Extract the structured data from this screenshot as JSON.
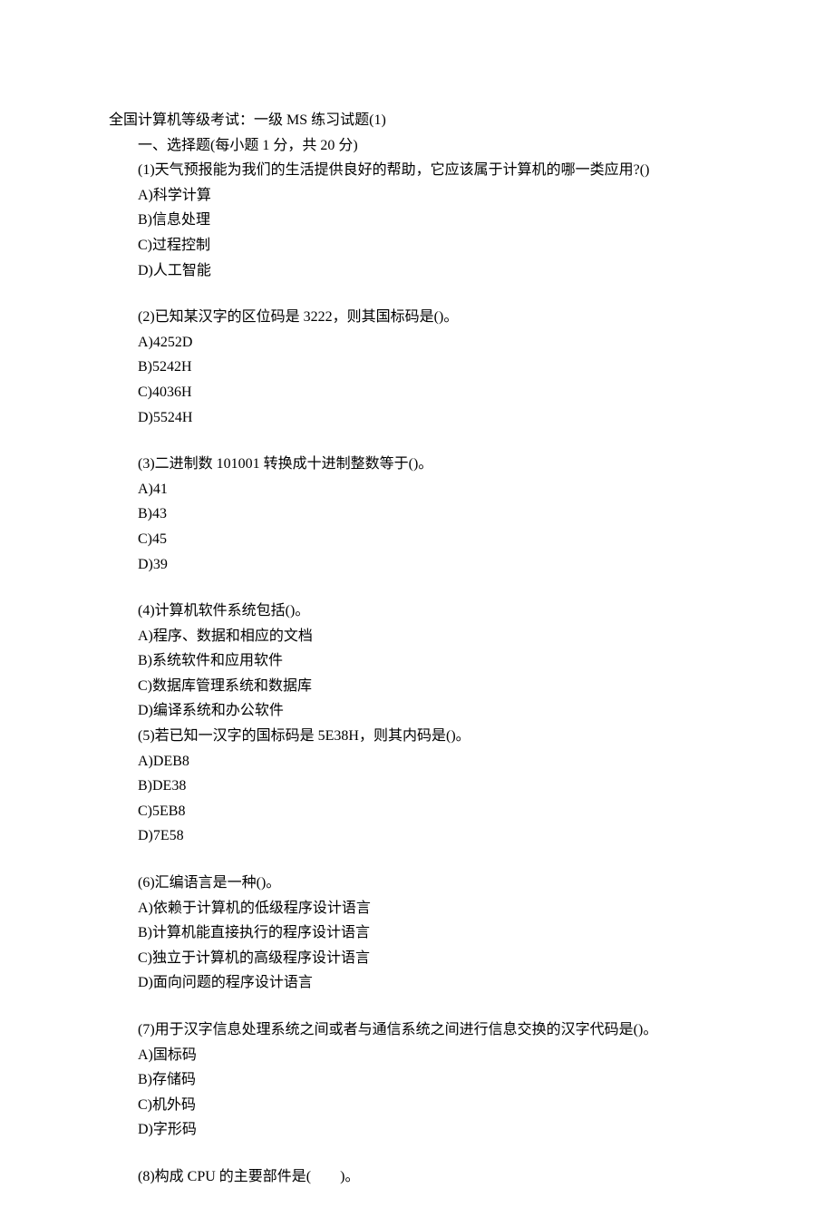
{
  "title": "全国计算机等级考试：一级 MS 练习试题(1)",
  "section_header": "一、选择题(每小题 1 分，共 20 分)",
  "questions": [
    {
      "prompt": "(1)天气预报能为我们的生活提供良好的帮助，它应该属于计算机的哪一类应用?()",
      "options": [
        "A)科学计算",
        "B)信息处理",
        "C)过程控制",
        "D)人工智能"
      ]
    },
    {
      "prompt": "(2)已知某汉字的区位码是 3222，则其国标码是()。",
      "options": [
        "A)4252D",
        "B)5242H",
        "C)4036H",
        "D)5524H"
      ]
    },
    {
      "prompt": "(3)二进制数 101001 转换成十进制整数等于()。",
      "options": [
        "A)41",
        "B)43",
        "C)45",
        "D)39"
      ]
    },
    {
      "prompt": "(4)计算机软件系统包括()。",
      "options": [
        "A)程序、数据和相应的文档",
        "B)系统软件和应用软件",
        "C)数据库管理系统和数据库",
        "D)编译系统和办公软件"
      ]
    },
    {
      "prompt": "(5)若已知一汉字的国标码是 5E38H，则其内码是()。",
      "options": [
        "A)DEB8",
        "B)DE38",
        "C)5EB8",
        "D)7E58"
      ]
    },
    {
      "prompt": "(6)汇编语言是一种()。",
      "options": [
        "A)依赖于计算机的低级程序设计语言",
        "B)计算机能直接执行的程序设计语言",
        "C)独立于计算机的高级程序设计语言",
        "D)面向问题的程序设计语言"
      ]
    },
    {
      "prompt": "(7)用于汉字信息处理系统之间或者与通信系统之间进行信息交换的汉字代码是()。",
      "options": [
        "A)国标码",
        "B)存储码",
        "C)机外码",
        "D)字形码"
      ]
    },
    {
      "prompt": "(8)构成 CPU 的主要部件是(　　)。",
      "options": []
    }
  ]
}
